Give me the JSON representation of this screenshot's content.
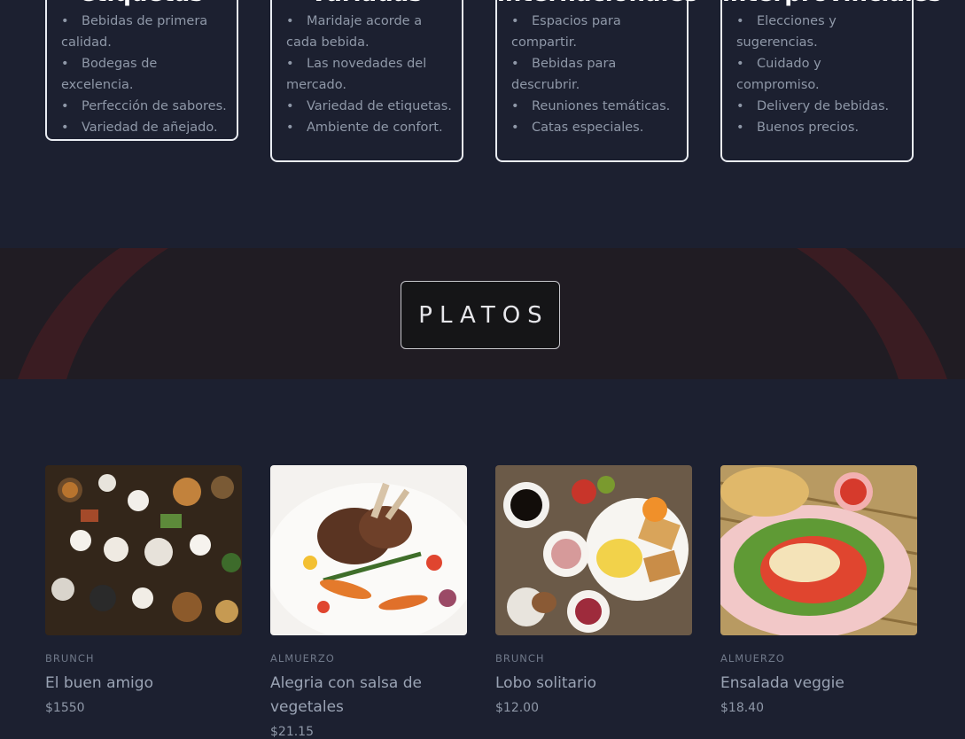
{
  "features": [
    {
      "title": "etiquetas",
      "items": [
        "Bebidas de primera calidad.",
        "Bodegas de excelencia.",
        "Perfección de sabores.",
        "Variedad de añejado."
      ]
    },
    {
      "title": "variadas",
      "items": [
        "Maridaje acorde a cada bebida.",
        "Las novedades del mercado.",
        "Variedad de etiquetas.",
        "Ambiente de confort."
      ]
    },
    {
      "title": "internacionales",
      "items": [
        "Espacios para compartir.",
        "Bebidas para descrubrir.",
        "Reuniones temáticas.",
        "Catas especiales."
      ]
    },
    {
      "title": "interprovinciales",
      "items": [
        "Elecciones y sugerencias.",
        "Cuidado y compromiso.",
        "Delivery de bebidas.",
        "Buenos precios."
      ]
    }
  ],
  "section": {
    "title": "PLATOS"
  },
  "dishes": [
    {
      "category": "BRUNCH",
      "name": "El buen amigo",
      "price": "$1550",
      "image": "brunch-table-photo"
    },
    {
      "category": "ALMUERZO",
      "name": "Alegria con salsa de vegetales",
      "price": "$21.15",
      "image": "lamb-chops-photo"
    },
    {
      "category": "BRUNCH",
      "name": "Lobo solitario",
      "price": "$12.00",
      "image": "breakfast-spread-photo"
    },
    {
      "category": "ALMUERZO",
      "name": "Ensalada veggie",
      "price": "$18.40",
      "image": "salad-plate-photo"
    }
  ],
  "colors": {
    "background": "#1c2030",
    "banner": "#201c23",
    "accent_arc": "#3f1d22"
  }
}
